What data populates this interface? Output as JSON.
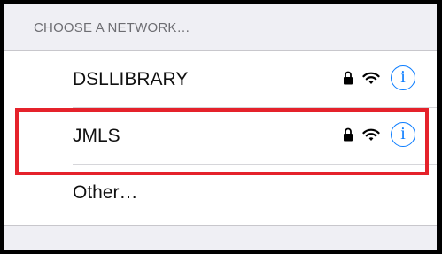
{
  "section": {
    "header": "CHOOSE A NETWORK…"
  },
  "networks": [
    {
      "name": "DSLLIBRARY",
      "lock_icon": "lock-icon",
      "wifi_icon": "wifi-icon",
      "info_icon": "info-icon",
      "info_glyph": "i"
    },
    {
      "name": "JMLS",
      "lock_icon": "lock-icon",
      "wifi_icon": "wifi-icon",
      "info_icon": "info-icon",
      "info_glyph": "i"
    }
  ],
  "other": {
    "label": "Other…"
  },
  "colors": {
    "accent": "#0a7cff",
    "highlight": "#e5222b",
    "background": "#efeff4",
    "header_text": "#6d6d72"
  }
}
